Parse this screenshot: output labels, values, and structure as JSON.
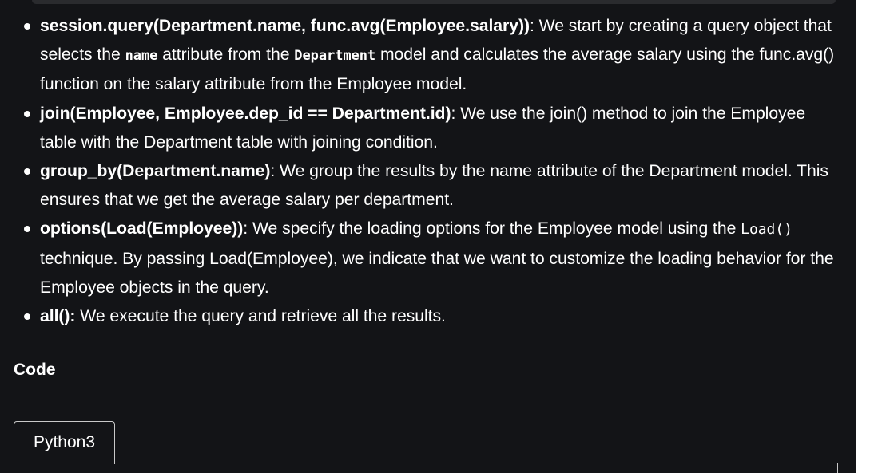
{
  "bullets": [
    {
      "term": "session.query(Department.name, func.avg(Employee.salary))",
      "sep": ":",
      "t1": " We start by creating a query object that selects the ",
      "code1": "name",
      "t2": " attribute from the ",
      "code2": "Department",
      "t3": " model and calculates the average salary using the func.avg() function on the salary attribute from the Employee model."
    },
    {
      "term": "join(Employee, Employee.dep_id == Department.id)",
      "sep": ":",
      "text": " We use the join() method to join the Employee table with the Department table with joining condition."
    },
    {
      "term": "group_by(Department.name)",
      "sep": ":",
      "text": " We group the results by the name attribute of the Department model. This ensures that we get the average salary per department."
    },
    {
      "term": "options(Load(Employee))",
      "sep": ":",
      "t1": " We specify the loading options for the Employee model using the ",
      "code1": "Load()",
      "t2": " technique. By passing Load(Employee), we indicate that we want to customize the loading behavior for the Employee objects in the query."
    },
    {
      "term": "all():",
      "text": " We execute the query and retrieve all the results."
    }
  ],
  "section_title": "Code",
  "tab_label": "Python3"
}
